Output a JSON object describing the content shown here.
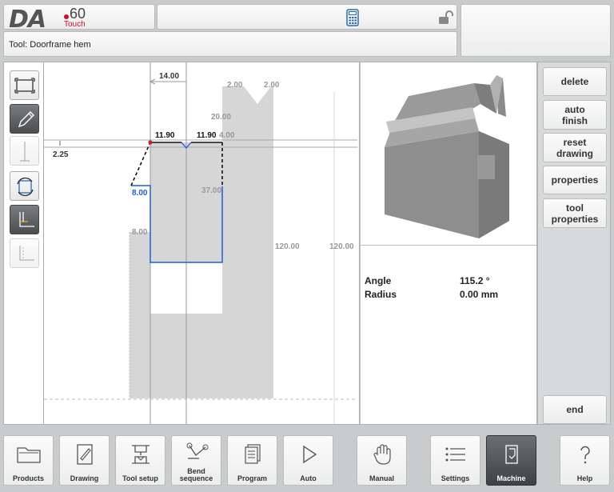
{
  "header": {
    "logo_brand": "DA",
    "logo_model": "60",
    "logo_sub": "Touch",
    "tool_title": "Tool: Doorframe hem"
  },
  "drawing": {
    "dims": {
      "top_width": "14.00",
      "left_offset": "2.25",
      "flange_left": "11.90",
      "flange_right": "11.90",
      "flange_right_gray": "4.00",
      "vee_left": "2.00",
      "vee_right": "2.00",
      "vee_depth": "20.00",
      "side_left_blue": "8.00",
      "side_left_gray": "8.00",
      "side_right": "37.00",
      "height_a": "120.00",
      "height_b": "120.00"
    }
  },
  "properties": {
    "angle_label": "Angle",
    "angle_value": "115.2 °",
    "radius_label": "Radius",
    "radius_value": "0.00 mm"
  },
  "side_buttons": {
    "delete": "delete",
    "auto_finish_1": "auto",
    "auto_finish_2": "finish",
    "reset_1": "reset",
    "reset_2": "drawing",
    "properties": "properties",
    "tool_props_1": "tool",
    "tool_props_2": "properties",
    "end": "end"
  },
  "nav": {
    "products": "Products",
    "drawing": "Drawing",
    "tool_setup": "Tool setup",
    "bend_1": "Bend",
    "bend_2": "sequence",
    "program": "Program",
    "auto": "Auto",
    "manual": "Manual",
    "settings": "Settings",
    "machine": "Machine",
    "help": "Help"
  },
  "colors": {
    "accent_blue": "#1e5fd6",
    "tool_gray": "#d6d6d6",
    "point_red": "#d0202a"
  }
}
